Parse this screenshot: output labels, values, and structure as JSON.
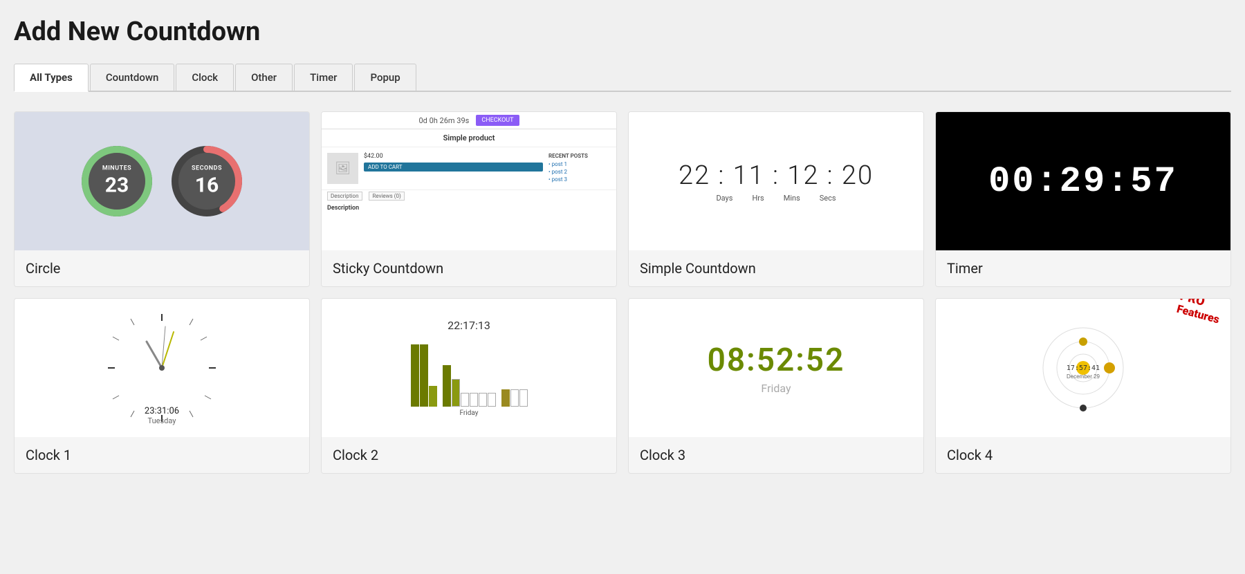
{
  "page": {
    "title": "Add New Countdown"
  },
  "tabs": [
    {
      "id": "all",
      "label": "All Types",
      "active": true
    },
    {
      "id": "countdown",
      "label": "Countdown",
      "active": false
    },
    {
      "id": "clock",
      "label": "Clock",
      "active": false
    },
    {
      "id": "other",
      "label": "Other",
      "active": false
    },
    {
      "id": "timer",
      "label": "Timer",
      "active": false
    },
    {
      "id": "popup",
      "label": "Popup",
      "active": false
    }
  ],
  "cards": [
    {
      "id": "circle",
      "label": "Circle",
      "type": "circle",
      "minutes": "23",
      "seconds": "16"
    },
    {
      "id": "sticky-countdown",
      "label": "Sticky Countdown",
      "type": "sticky",
      "bar_text": "0d 0h 26m 39s",
      "btn_label": "CHECKOUT",
      "product_title": "Simple product",
      "product_price": "$42.00",
      "add_to_cart": "ADD TO CART",
      "description_tab": "Description",
      "reviews_tab": "Reviews (0)"
    },
    {
      "id": "simple-countdown",
      "label": "Simple Countdown",
      "type": "simple",
      "time": "22 : 11 : 12 : 20",
      "labels": [
        "Days",
        "Hrs",
        "Mins",
        "Secs"
      ]
    },
    {
      "id": "timer",
      "label": "Timer",
      "type": "timer",
      "time": "00:29:57"
    },
    {
      "id": "clock1",
      "label": "Clock 1",
      "type": "clock1",
      "time": "23:31:06",
      "day": "Tuesday"
    },
    {
      "id": "clock2",
      "label": "Clock 2",
      "type": "clock2",
      "time": "22:17:13",
      "day": "Friday"
    },
    {
      "id": "clock3",
      "label": "Clock 3",
      "type": "clock3",
      "time": "08:52:52",
      "day": "Friday"
    },
    {
      "id": "clock4",
      "label": "Clock 4",
      "type": "clock4",
      "pro_line1": "PRO",
      "pro_line2": "Features",
      "time": "17:57:41",
      "date": "December 29"
    }
  ]
}
